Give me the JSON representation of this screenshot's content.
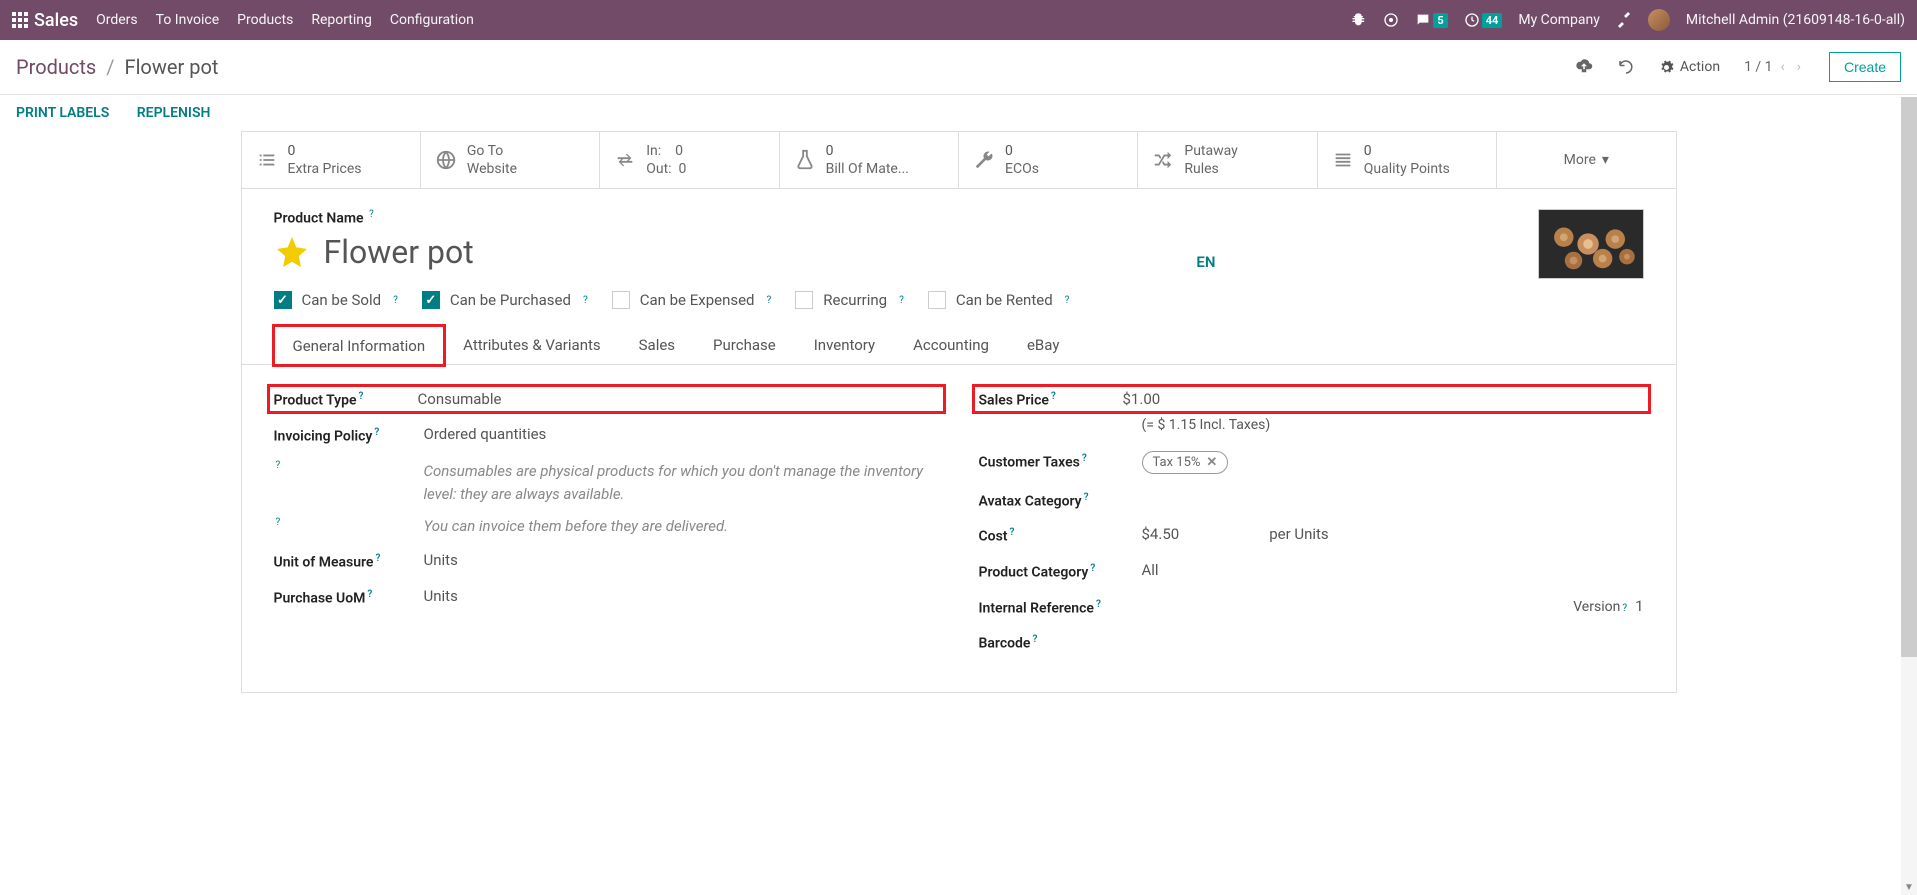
{
  "navbar": {
    "brand": "Sales",
    "links": [
      "Orders",
      "To Invoice",
      "Products",
      "Reporting",
      "Configuration"
    ],
    "messages_count": "5",
    "activities_count": "44",
    "company": "My Company",
    "user": "Mitchell Admin (21609148-16-0-all)"
  },
  "breadcrumb": {
    "parent": "Products",
    "current": "Flower pot"
  },
  "controlbar": {
    "action_label": "Action",
    "pager": "1 / 1",
    "create_label": "Create"
  },
  "action_buttons": {
    "print_labels": "PRINT LABELS",
    "replenish": "REPLENISH"
  },
  "stats": [
    {
      "value": "0",
      "label": "Extra Prices"
    },
    {
      "value": "",
      "label": "Go To\nWebsite"
    },
    {
      "value": "In:    0\nOut:  0",
      "label": ""
    },
    {
      "value": "0",
      "label": "Bill Of Mate..."
    },
    {
      "value": "0",
      "label": "ECOs"
    },
    {
      "value": "",
      "label": "Putaway\nRules"
    },
    {
      "value": "0",
      "label": "Quality Points"
    }
  ],
  "stat_more": "More",
  "title": {
    "label": "Product Name",
    "value": "Flower pot",
    "lang": "EN"
  },
  "checks": [
    {
      "label": "Can be Sold",
      "checked": true
    },
    {
      "label": "Can be Purchased",
      "checked": true
    },
    {
      "label": "Can be Expensed",
      "checked": false
    },
    {
      "label": "Recurring",
      "checked": false
    },
    {
      "label": "Can be Rented",
      "checked": false
    }
  ],
  "tabs": [
    "General Information",
    "Attributes & Variants",
    "Sales",
    "Purchase",
    "Inventory",
    "Accounting",
    "eBay"
  ],
  "fields_left": {
    "product_type_label": "Product Type",
    "product_type_value": "Consumable",
    "invoicing_policy_label": "Invoicing Policy",
    "invoicing_policy_value": "Ordered quantities",
    "help1": "Consumables are physical products for which you don't manage the inventory level: they are always available.",
    "help2": "You can invoice them before they are delivered.",
    "uom_label": "Unit of Measure",
    "uom_value": "Units",
    "purchase_uom_label": "Purchase UoM",
    "purchase_uom_value": "Units"
  },
  "fields_right": {
    "sales_price_label": "Sales Price",
    "sales_price_value": "$1.00",
    "sales_price_incl": "(= $ 1.15 Incl. Taxes)",
    "customer_taxes_label": "Customer Taxes",
    "tax_tag": "Tax 15%",
    "avatax_label": "Avatax Category",
    "cost_label": "Cost",
    "cost_value": "$4.50",
    "cost_per": "per Units",
    "category_label": "Product Category",
    "category_value": "All",
    "internal_ref_label": "Internal Reference",
    "version_label": "Version",
    "version_value": "1",
    "barcode_label": "Barcode"
  }
}
